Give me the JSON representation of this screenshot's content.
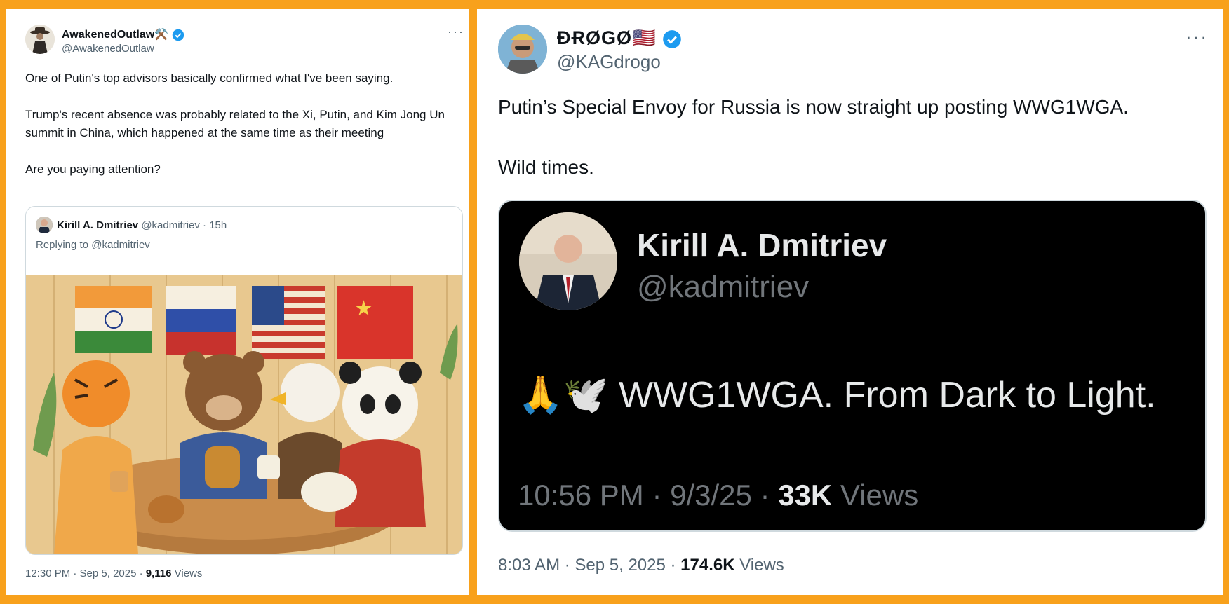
{
  "left_tweet": {
    "name": "AwakenedOutlaw",
    "name_emoji": "⚒️",
    "handle": "@AwakenedOutlaw",
    "more": "···",
    "paragraphs": [
      "One of Putin's top advisors basically confirmed what I've been saying.",
      "Trump's recent absence was probably related to the Xi, Putin, and Kim Jong Un summit in China, which happened at the same time as their meeting",
      "Are you paying attention?"
    ],
    "quote": {
      "name": "Kirill A. Dmitriev",
      "handle_time": "@kadmitriev · 15h",
      "replying": "Replying to @kadmitriev"
    },
    "time": "12:30 PM · Sep 5, 2025 · ",
    "views_count": "9,116",
    "views_label": " Views"
  },
  "right_tweet": {
    "name": "ÐɌØGØ🇺🇸",
    "handle": "@KAGdrogo",
    "more": "···",
    "paragraphs": [
      "Putin’s Special Envoy for Russia is now straight up posting WWG1WGA.",
      "Wild times."
    ],
    "embed": {
      "name": "Kirill A. Dmitriev",
      "handle": "@kadmitriev",
      "text": "🙏🕊️ WWG1WGA. From Dark to Light.",
      "time": "10:56 PM · 9/3/25 · ",
      "views_count": "33K",
      "views_label": " Views"
    },
    "time": "8:03 AM · Sep 5, 2025 · ",
    "views_count": "174.6K",
    "views_label": " Views"
  },
  "colors": {
    "frame": "#F8A11C",
    "verified": "#1D9BF0",
    "muted": "#536471"
  }
}
